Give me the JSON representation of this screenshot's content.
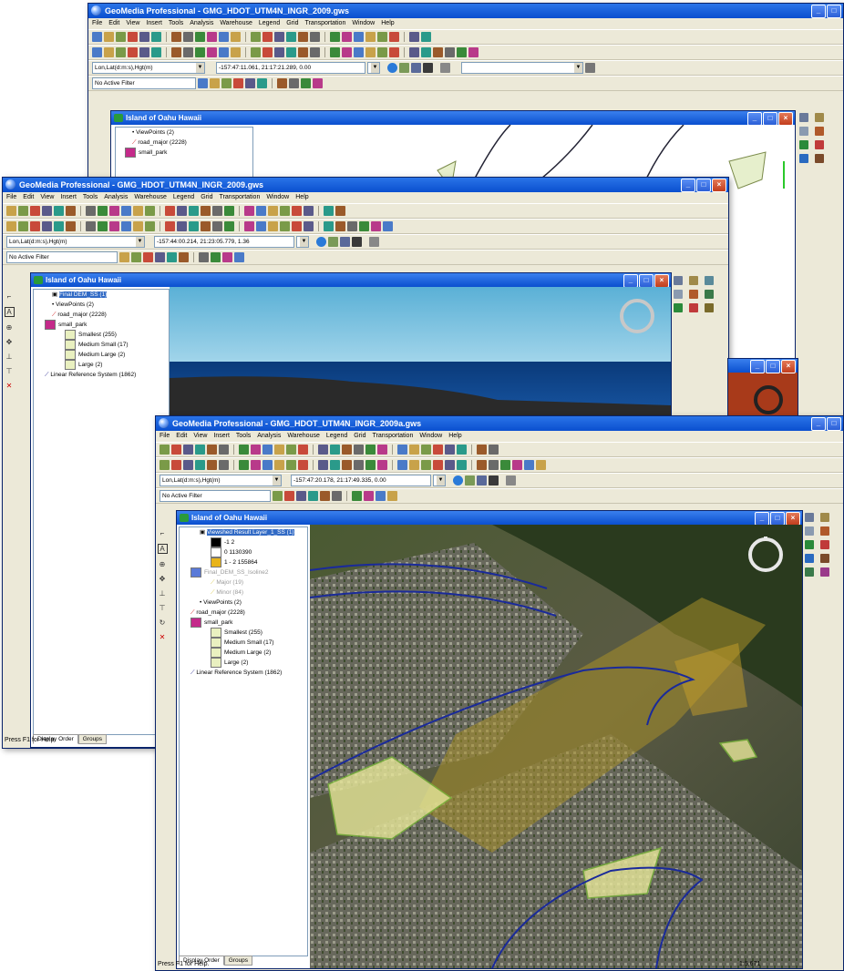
{
  "colors": {
    "accent": "#0a4fcf",
    "desktop": "#ffffff",
    "orthophoto": "#3a4a2c"
  },
  "win1": {
    "title": "GeoMedia Professional - GMG_HDOT_UTM4N_INGR_2009.gws",
    "menu": [
      "File",
      "Edit",
      "View",
      "Insert",
      "Tools",
      "Analysis",
      "Warehouse",
      "Legend",
      "Grid",
      "Transportation",
      "Window",
      "Help"
    ],
    "coord_system": "Lon,Lat(d:m:s),Hgt(m)",
    "coords": "-157:47:11.061, 21:17:21.289, 0.00",
    "filter": "No Active Filter",
    "map_title": "Island of Oahu Hawaii",
    "legend": [
      "ViewPoints (2)",
      "road_major (2228)",
      "small_park"
    ]
  },
  "win2": {
    "title": "GeoMedia Professional - GMG_HDOT_UTM4N_INGR_2009.gws",
    "menu": [
      "File",
      "Edit",
      "View",
      "Insert",
      "Tools",
      "Analysis",
      "Warehouse",
      "Legend",
      "Grid",
      "Transportation",
      "Window",
      "Help"
    ],
    "coord_system": "Lon,Lat(d:m:s),Hgt(m)",
    "coords": "-157:44:00.214, 21:23:05.779, 1.36",
    "filter": "No Active Filter",
    "map_title": "Island of Oahu Hawaii",
    "legend": [
      "Final DEM_SS (1)",
      "ViewPoints (2)",
      "road_major (2228)",
      "small_park",
      "Smallest (255)",
      "Medium Small (17)",
      "Medium Large (2)",
      "Large (2)",
      "Linear Reference System (1862)"
    ],
    "tabs": [
      "Display Order",
      "Groups"
    ],
    "status": "Press F1 for Help."
  },
  "win3": {
    "title": "GeoMedia Professional - GMG_HDOT_UTM4N_INGR_2009a.gws",
    "menu": [
      "File",
      "Edit",
      "View",
      "Insert",
      "Tools",
      "Analysis",
      "Warehouse",
      "Legend",
      "Grid",
      "Transportation",
      "Window",
      "Help"
    ],
    "coord_system": "Lon,Lat(d:m:s),Hgt(m)",
    "coords": "-157:47:20.178, 21:17:49.335, 0.00",
    "filter": "No Active Filter",
    "map_title": "Island of Oahu Hawaii",
    "legend": [
      "Viewshed Result Layer_1_SS (1)",
      "-1  2",
      "0  1130390",
      "1 - 2  155864",
      "Final_DEM_SS_Isoline2",
      "Major (19)",
      "Minor (84)",
      "ViewPoints (2)",
      "road_major (2228)",
      "small_park",
      "Smallest (255)",
      "Medium Small (17)",
      "Medium Large (2)",
      "Large (2)",
      "Linear Reference System (1862)"
    ],
    "tabs": [
      "Display Order",
      "Groups"
    ],
    "status": "Press F1 for Help.",
    "scale": "1:5,671"
  }
}
